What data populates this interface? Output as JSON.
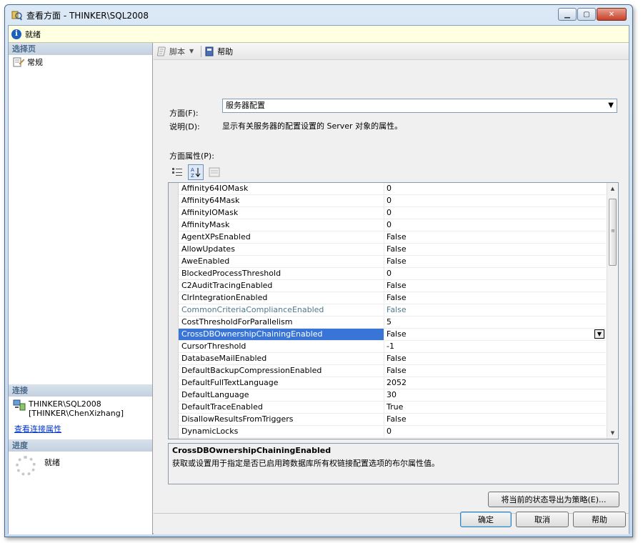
{
  "window": {
    "title": "查看方面 - THINKER\\SQL2008"
  },
  "status": {
    "text": "就绪"
  },
  "sidebar": {
    "select_page_header": "选择页",
    "pages": [
      {
        "label": "常规"
      }
    ],
    "connection_header": "连接",
    "connection_server": "THINKER\\SQL2008",
    "connection_user": "[THINKER\\ChenXizhang]",
    "view_connection_link": "查看连接属性",
    "progress_header": "进度",
    "progress_status": "就绪"
  },
  "toolbar": {
    "script_label": "脚本",
    "help_label": "帮助"
  },
  "form": {
    "facet_label": "方面(F):",
    "facet_value": "服务器配置",
    "description_label": "说明(D):",
    "description_value": "显示有关服务器的配置设置的 Server 对象的属性。",
    "properties_label": "方面属性(P):"
  },
  "properties": [
    {
      "name": "Affinity64IOMask",
      "value": "0"
    },
    {
      "name": "Affinity64Mask",
      "value": "0"
    },
    {
      "name": "AffinityIOMask",
      "value": "0"
    },
    {
      "name": "AffinityMask",
      "value": "0"
    },
    {
      "name": "AgentXPsEnabled",
      "value": "False"
    },
    {
      "name": "AllowUpdates",
      "value": "False"
    },
    {
      "name": "AweEnabled",
      "value": "False"
    },
    {
      "name": "BlockedProcessThreshold",
      "value": "0"
    },
    {
      "name": "C2AuditTracingEnabled",
      "value": "False"
    },
    {
      "name": "ClrIntegrationEnabled",
      "value": "False"
    },
    {
      "name": "CommonCriteriaComplianceEnabled",
      "value": "False",
      "readonly": true
    },
    {
      "name": "CostThresholdForParallelism",
      "value": "5"
    },
    {
      "name": "CrossDBOwnershipChainingEnabled",
      "value": "False",
      "selected": true
    },
    {
      "name": "CursorThreshold",
      "value": "-1"
    },
    {
      "name": "DatabaseMailEnabled",
      "value": "False"
    },
    {
      "name": "DefaultBackupCompressionEnabled",
      "value": "False"
    },
    {
      "name": "DefaultFullTextLanguage",
      "value": "2052"
    },
    {
      "name": "DefaultLanguage",
      "value": "30"
    },
    {
      "name": "DefaultTraceEnabled",
      "value": "True"
    },
    {
      "name": "DisallowResultsFromTriggers",
      "value": "False"
    },
    {
      "name": "DynamicLocks",
      "value": "0"
    }
  ],
  "help": {
    "title": "CrossDBOwnershipChainingEnabled",
    "text": "获取或设置用于指定是否已启用跨数据库所有权链接配置选项的布尔属性值。"
  },
  "buttons": {
    "export_policy": "将当前的状态导出为策略(E)...",
    "ok": "确定",
    "cancel": "取消",
    "help": "帮助"
  },
  "colors": {
    "selection": "#3875d7",
    "readonly_text": "#4c7a8c",
    "link": "#0033cc",
    "info_bar": "#ffffe1"
  }
}
